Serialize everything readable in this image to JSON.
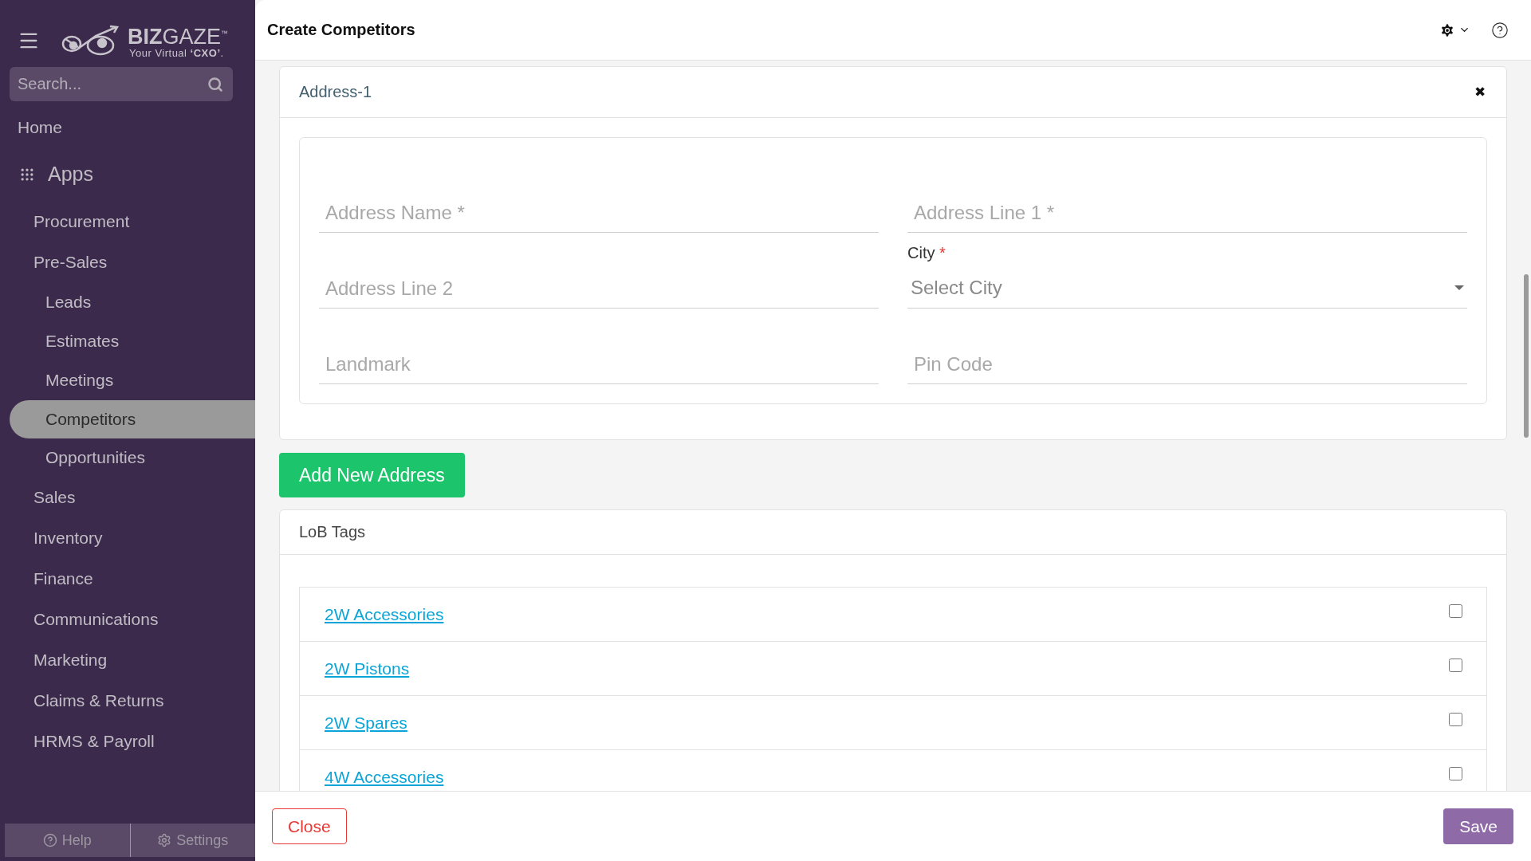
{
  "logo": {
    "bold": "BIZ",
    "light": "GAZE",
    "mark": "™",
    "tagline": "Your Virtual **‘CXO’**."
  },
  "search": {
    "placeholder": "Search..."
  },
  "nav": [
    {
      "label": "Home",
      "kind": "link",
      "selected": false
    },
    {
      "label": "Apps",
      "kind": "heading",
      "selected": false
    },
    {
      "label": "Procurement",
      "kind": "group",
      "selected": false
    },
    {
      "label": "Pre-Sales",
      "kind": "group",
      "selected": false,
      "children": [
        {
          "label": "Leads",
          "selected": false
        },
        {
          "label": "Estimates",
          "selected": false
        },
        {
          "label": "Meetings",
          "selected": false
        },
        {
          "label": "Competitors",
          "selected": true
        },
        {
          "label": "Opportunities",
          "selected": false
        }
      ]
    },
    {
      "label": "Sales",
      "kind": "group",
      "selected": false
    },
    {
      "label": "Inventory",
      "kind": "group",
      "selected": false
    },
    {
      "label": "Finance",
      "kind": "group",
      "selected": false
    },
    {
      "label": "Communications",
      "kind": "group",
      "selected": false
    },
    {
      "label": "Marketing",
      "kind": "group",
      "selected": false
    },
    {
      "label": "Claims & Returns",
      "kind": "group",
      "selected": false
    },
    {
      "label": "HRMS & Payroll",
      "kind": "group",
      "selected": false
    }
  ],
  "sidebar_footer": [
    "Help",
    "Settings"
  ],
  "page_title": "Create Competitors",
  "address": {
    "title": "Address-1",
    "close": "✖",
    "city_label": {
      "text": "City",
      "required_mark": "*"
    },
    "fields": [
      {
        "kind": "text",
        "placeholder": "Address Name *"
      },
      {
        "kind": "text",
        "placeholder": "Address Line 1 *"
      },
      {
        "kind": "text",
        "placeholder": "Address Line 2"
      },
      {
        "kind": "select",
        "placeholder": "Select City"
      },
      {
        "kind": "text",
        "placeholder": "Landmark"
      },
      {
        "kind": "text",
        "placeholder": "Pin Code"
      }
    ]
  },
  "add_address": "Add New Address",
  "lob": {
    "title": "LoB Tags",
    "tags": [
      {
        "label": "2W Accessories",
        "checked": false
      },
      {
        "label": "2W Pistons",
        "checked": false
      },
      {
        "label": "2W Spares",
        "checked": false
      },
      {
        "label": "4W Accessories",
        "checked": false
      }
    ]
  },
  "footer": {
    "close": "Close",
    "save": "Save"
  }
}
